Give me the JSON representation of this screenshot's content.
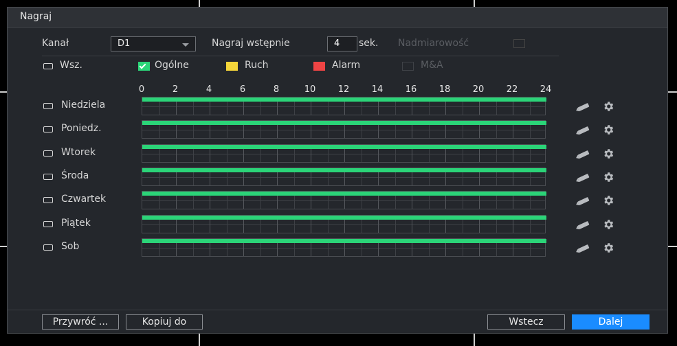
{
  "window": {
    "title": "Nagraj"
  },
  "top_row": {
    "channel_label": "Kanał",
    "channel_value": "D1",
    "prerecord_label": "Nagraj wstępnie",
    "prerecord_value": "4",
    "prerecord_unit": "sek.",
    "redundancy_label": "Nadmiarowość"
  },
  "legend": {
    "all_label": "Wsz.",
    "general_label": "Ogólne",
    "motion_label": "Ruch",
    "alarm_label": "Alarm",
    "ma_label": "M&A"
  },
  "hours": [
    "0",
    "2",
    "4",
    "6",
    "8",
    "10",
    "12",
    "14",
    "16",
    "18",
    "20",
    "22",
    "24"
  ],
  "days": [
    {
      "label": "Niedziela",
      "coverage": [
        0,
        24
      ]
    },
    {
      "label": "Poniedz.",
      "coverage": [
        0,
        24
      ]
    },
    {
      "label": "Wtorek",
      "coverage": [
        0,
        24
      ]
    },
    {
      "label": "Środa",
      "coverage": [
        0,
        24
      ]
    },
    {
      "label": "Czwartek",
      "coverage": [
        0,
        24
      ]
    },
    {
      "label": "Piątek",
      "coverage": [
        0,
        24
      ]
    },
    {
      "label": "Sob",
      "coverage": [
        0,
        24
      ]
    }
  ],
  "buttons": {
    "restore": "Przywróć ...",
    "copy_to": "Kopiuj do",
    "back": "Wstecz",
    "next": "Dalej"
  },
  "colors": {
    "general": "#2bd478",
    "motion": "#f5d63a",
    "alarm": "#ef4444",
    "primary_button": "#1a8cff"
  },
  "icons": {
    "edit": "pencil-icon",
    "settings": "gear-icon"
  }
}
